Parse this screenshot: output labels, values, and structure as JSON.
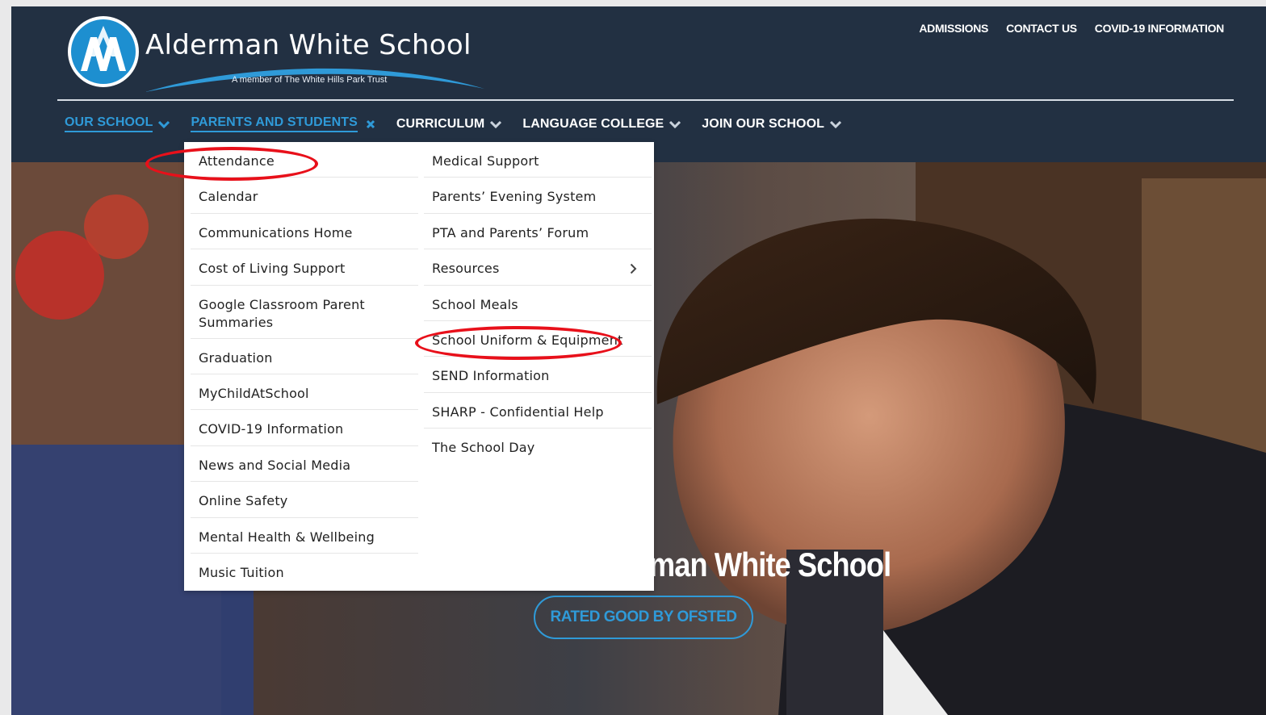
{
  "header": {
    "school_name": "Alderman White School",
    "tagline": "A member of The White Hills Park Trust",
    "logo_letters": "AW",
    "top_links": [
      "ADMISSIONS",
      "CONTACT US",
      "COVID-19 INFORMATION"
    ]
  },
  "main_nav": {
    "items": [
      {
        "label": "OUR SCHOOL",
        "state": "active",
        "icon": "chevron-down-icon"
      },
      {
        "label": "PARENTS AND STUDENTS",
        "state": "open",
        "icon": "close-icon"
      },
      {
        "label": "CURRICULUM",
        "state": "",
        "icon": "chevron-down-icon"
      },
      {
        "label": "LANGUAGE COLLEGE",
        "state": "",
        "icon": "chevron-down-icon"
      },
      {
        "label": "JOIN OUR SCHOOL",
        "state": "",
        "icon": "chevron-down-icon"
      }
    ]
  },
  "dropdown": {
    "left_column": [
      "Attendance",
      "Calendar",
      "Communications Home",
      "Cost of Living Support",
      "Google Classroom Parent Summaries",
      "Graduation",
      "MyChildAtSchool",
      "COVID-19 Information",
      "News and Social Media",
      "Online Safety",
      "Mental Health & Wellbeing",
      "Music Tuition"
    ],
    "right_column": [
      "Medical Support",
      "Parents’ Evening System",
      "PTA and Parents’ Forum",
      "Resources",
      "School Meals",
      "School Uniform & Equipment",
      "SEND Information",
      "SHARP - Confidential Help",
      "The School Day"
    ],
    "highlighted": [
      "Attendance",
      "School Uniform & Equipment"
    ]
  },
  "hero": {
    "title": "man White School",
    "cta": "RATED GOOD BY OFSTED"
  },
  "colors": {
    "header_bg": "#223042",
    "accent": "#2f9ad8",
    "highlight_ring": "#e8101a"
  }
}
